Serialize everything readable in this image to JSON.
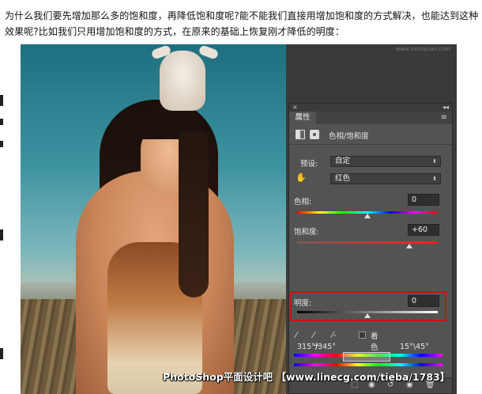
{
  "article": {
    "paragraph": "为什么我们要先增加那么多的饱和度，再降低饱和度呢?能不能我们直接用增加饱和度的方式解决，也能达到这种效果呢?比如我们只用增加饱和度的方式，在原来的基础上恢复刚才降低的明度："
  },
  "screenshot": {
    "top_watermark": "www.missyuan.com",
    "footer_watermark": "PhotoShop平面设计吧 【www.linecg.com/tieba/1783】"
  },
  "panel": {
    "close_glyph": "×",
    "collapse_glyph": "◂◂",
    "tab_label": "属性",
    "menu_glyph": "≡",
    "adjustment_title": "色相/饱和度",
    "preset_label": "预设:",
    "preset_value": "自定",
    "channel_value": "红色",
    "dropdown_arrow": "⬍",
    "hand_glyph": "✋",
    "hue": {
      "label": "色相:",
      "value": "0",
      "level": 0.5
    },
    "saturation": {
      "label": "饱和度:",
      "value": "+60",
      "level": 0.8
    },
    "lightness": {
      "label": "明度:",
      "value": "0",
      "level": 0.5
    },
    "eyedropper_glyph": "⁄",
    "eyedropper_plus_glyph": "⁄+",
    "eyedropper_minus_glyph": "⁄-",
    "colorize_label": "着色",
    "range_left": "315°/345°",
    "range_right": "15°\\45°",
    "bottom_icons": {
      "clip": "⬚",
      "view_prev": "◉",
      "reset": "↺",
      "visibility": "◉",
      "delete": "🗑"
    }
  },
  "colors": {
    "panel_bg": "#535353",
    "highlight": "#d01010"
  }
}
